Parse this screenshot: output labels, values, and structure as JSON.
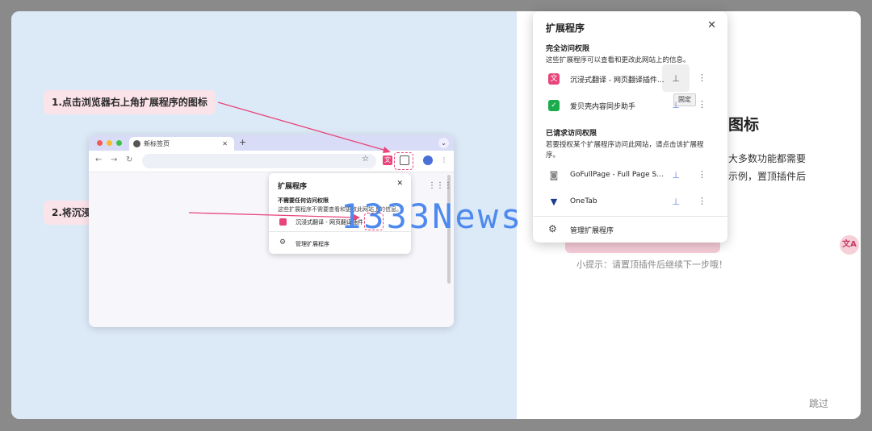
{
  "left": {
    "step1": "1.点击浏览器右上角扩展程序的图标",
    "step2": "2.将沉浸式翻译固定到工具栏"
  },
  "mini_browser": {
    "tab_title": "新标签页",
    "tab_close": "✕",
    "new_tab": "+",
    "popup_title": "扩展程序",
    "popup_close": "✕",
    "popup_heading": "不需要任何访问权限",
    "popup_desc": "这些扩展程序不需要查看和更改此网站上的信息。",
    "popup_item": "沉浸式翻译 - 网页翻译插件",
    "popup_manage": "管理扩展程序"
  },
  "right": {
    "title": "图标",
    "line1": "大多数功能都需要",
    "line2": "示例，置顶插件后",
    "tip": "小提示：请置顶插件后继续下一步哦！",
    "skip": "跳过"
  },
  "extensions_popup": {
    "title": "扩展程序",
    "close": "✕",
    "full_access_heading": "完全访问权限",
    "full_access_desc": "这些扩展程序可以查看和更改此网站上的信息。",
    "items_full": [
      {
        "name": "沉浸式翻译 - 网页翻译插件...",
        "icon": "immersive-translate-icon",
        "color": "#e8457a"
      },
      {
        "name": "爱贝壳内容同步助手",
        "icon": "check-icon",
        "color": "#1aab4c"
      }
    ],
    "tooltip": "固定",
    "requested_heading": "已请求访问权限",
    "requested_desc1": "若要授权某个扩展程序访问此网站，请点击该扩展程",
    "requested_desc2": "序。",
    "items_requested": [
      {
        "name": "GoFullPage - Full Page S...",
        "icon": "camera-icon",
        "color": "#888888"
      },
      {
        "name": "OneTab",
        "icon": "onetab-icon",
        "color": "#1c3d8c"
      }
    ],
    "manage": "管理扩展程序"
  },
  "watermark": "1333News",
  "translate_badge": "文A",
  "colors": {
    "accent": "#e8457a",
    "pin_blue": "#5a7fe0",
    "left_bg": "#dce9f7"
  }
}
